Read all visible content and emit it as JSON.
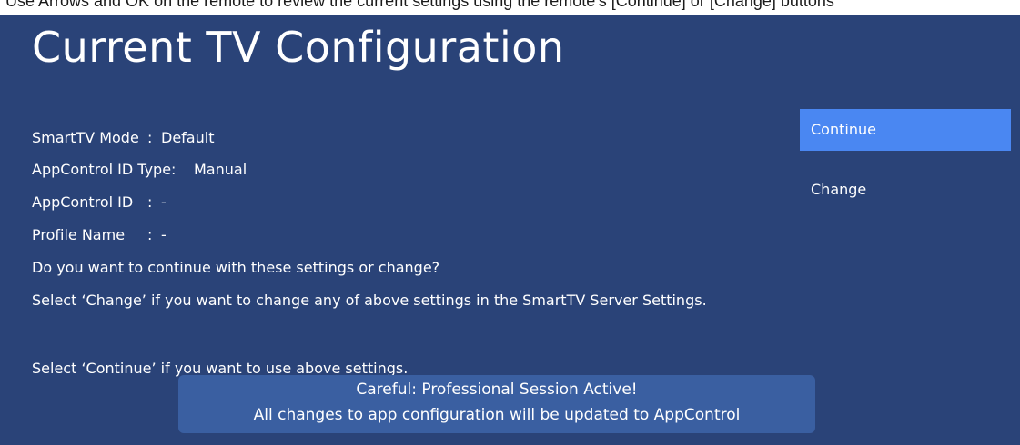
{
  "instruction_banner": "Use Arrows and OK on the remote to review the current settings using the remote's [Continue] or [Change] buttons",
  "title": "Current TV Configuration",
  "settings": [
    {
      "label": "SmartTV Mode",
      "separator": ":",
      "value": "Default"
    },
    {
      "label": "AppControl ID Type:",
      "separator": "",
      "value": "Manual"
    },
    {
      "label": "AppControl ID",
      "separator": ":",
      "value": "-"
    },
    {
      "label": "Profile Name",
      "separator": ":",
      "value": "-"
    }
  ],
  "prompt_question": "Do you want to continue with these settings or change?",
  "prompt_change": "Select ‘Change’ if you want to change any of above settings in the SmartTV Server Settings.",
  "prompt_continue": "Select ‘Continue’ if you want to use above settings.",
  "menu": {
    "continue_label": "Continue",
    "change_label": "Change",
    "selected": "Continue"
  },
  "toast": {
    "line1": "Careful: Professional Session Active!",
    "line2": "All changes to app configuration will be updated to AppControl"
  },
  "colors": {
    "background": "#2a4378",
    "selected_item": "#4a87f2",
    "toast_background": "#3a5fa1"
  }
}
